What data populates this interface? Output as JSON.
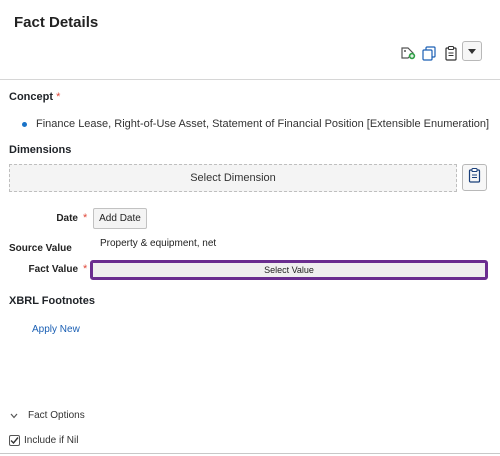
{
  "header": {
    "title": "Fact Details"
  },
  "toolbar": {
    "icons": [
      "tag-add-icon",
      "copy-icon",
      "clipboard-icon",
      "chevron-down-icon"
    ]
  },
  "concept": {
    "label": "Concept",
    "required_mark": "*",
    "value": "Finance Lease, Right-of-Use Asset, Statement of Financial Position [Extensible Enumeration]"
  },
  "dimensions": {
    "label": "Dimensions",
    "select_label": "Select Dimension"
  },
  "date": {
    "label": "Date",
    "required_mark": "*",
    "button_label": "Add Date"
  },
  "source_value": {
    "label": "Source Value",
    "value": "Property & equipment, net"
  },
  "fact_value": {
    "label": "Fact Value",
    "required_mark": "*",
    "select_label": "Select Value"
  },
  "footnotes": {
    "label": "XBRL Footnotes",
    "apply_label": "Apply New"
  },
  "fact_options": {
    "label": "Fact Options",
    "include_nil_label": "Include if Nil",
    "include_nil_checked": true
  },
  "colors": {
    "accent": "#6a2d8f",
    "link": "#1a5fb4",
    "required": "#e0483b",
    "bullet": "#1a73c8"
  }
}
